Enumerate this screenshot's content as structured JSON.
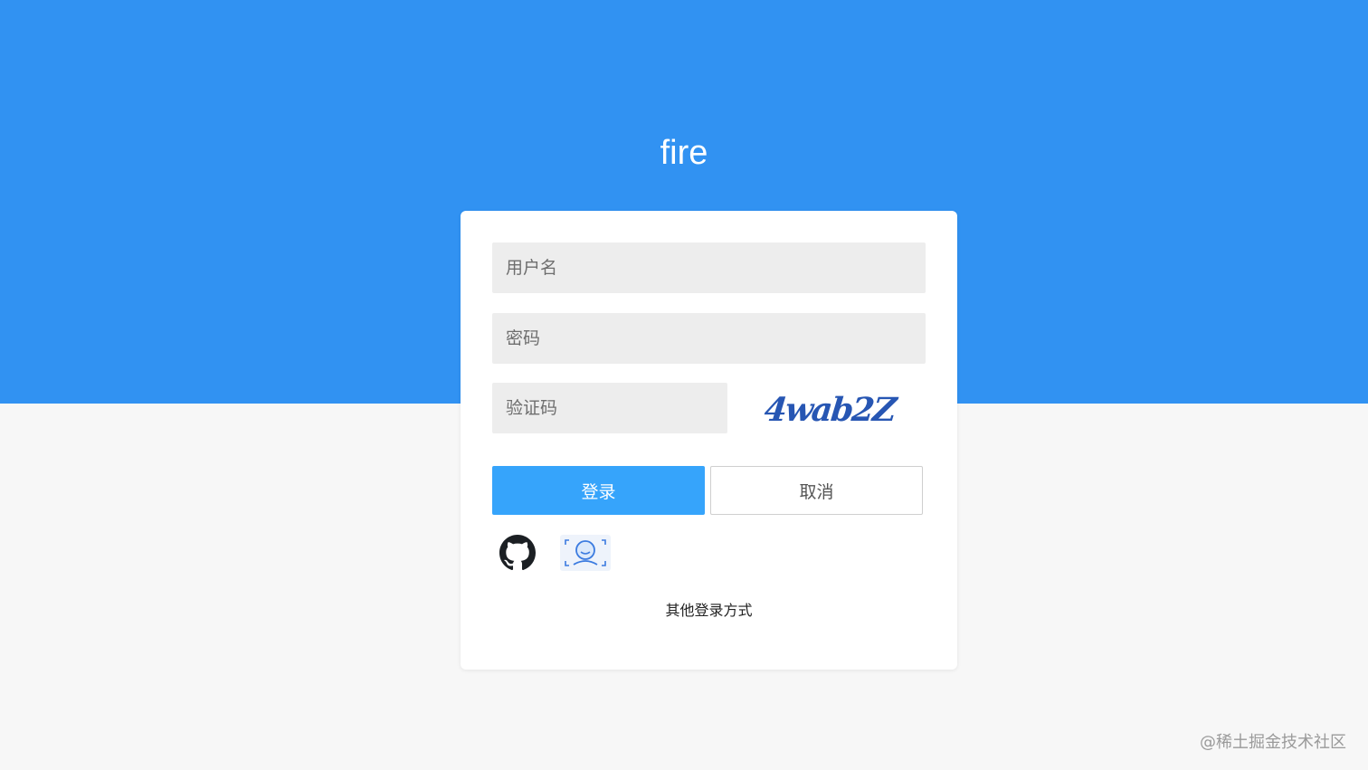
{
  "app": {
    "title": "fire"
  },
  "form": {
    "username_placeholder": "用户名",
    "password_placeholder": "密码",
    "captcha_placeholder": "验证码",
    "captcha_image_text": "4wab2Z"
  },
  "buttons": {
    "login": "登录",
    "cancel": "取消"
  },
  "alt_login": {
    "icons": [
      "github-icon",
      "face-recognition-icon"
    ],
    "label": "其他登录方式"
  },
  "watermark": "@稀土掘金技术社区",
  "colors": {
    "header_blue": "#3192f2",
    "login_button": "#36a4fb",
    "page_background": "#f7f7f7",
    "input_background": "#ededed",
    "captcha_text": "#2756b3"
  }
}
